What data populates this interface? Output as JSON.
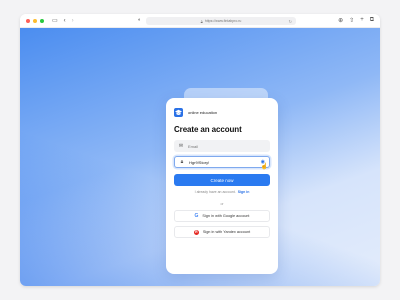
{
  "browser": {
    "url": "https://www.fintabpro.ru",
    "lights": [
      "#ff5f57",
      "#febc2e",
      "#28c840"
    ]
  },
  "brand": {
    "name": "online education"
  },
  "form": {
    "title": "Create an account",
    "email_placeholder": "Email",
    "password_value": "Hgr9!Story!",
    "create_label": "Create now",
    "have_account_text": "I already have an account.",
    "signin_link": "Sign in",
    "or_text": "or",
    "google_label": "Sign in with Google account",
    "yandex_label": "Sign in with Yandex account"
  }
}
